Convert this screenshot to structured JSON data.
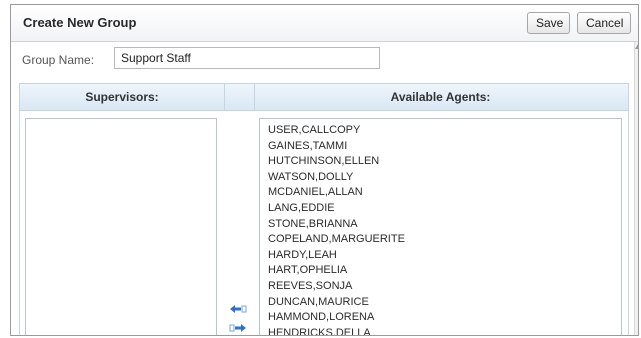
{
  "dialog": {
    "title": "Create New Group",
    "save_label": "Save",
    "cancel_label": "Cancel"
  },
  "group_name": {
    "label": "Group Name:",
    "value": "Support Staff"
  },
  "columns": {
    "supervisors": "Supervisors:",
    "available": "Available Agents:"
  },
  "supervisors": [],
  "available_agents": [
    "USER,CALLCOPY",
    "GAINES,TAMMI",
    "HUTCHINSON,ELLEN",
    "WATSON,DOLLY",
    "MCDANIEL,ALLAN",
    "LANG,EDDIE",
    "STONE,BRIANNA",
    "COPELAND,MARGUERITE",
    "HARDY,LEAH",
    "HART,OPHELIA",
    "REEVES,SONJA",
    "DUNCAN,MAURICE",
    "HAMMOND,LORENA",
    "HENDRICKS,DELLA"
  ],
  "icons": {
    "move_left": "arrow-left-icon",
    "move_right": "arrow-right-icon"
  },
  "colors": {
    "header_gradient_top": "#eef5fb",
    "header_gradient_bottom": "#d9e8f4",
    "arrow_blue": "#2f6fcf"
  }
}
